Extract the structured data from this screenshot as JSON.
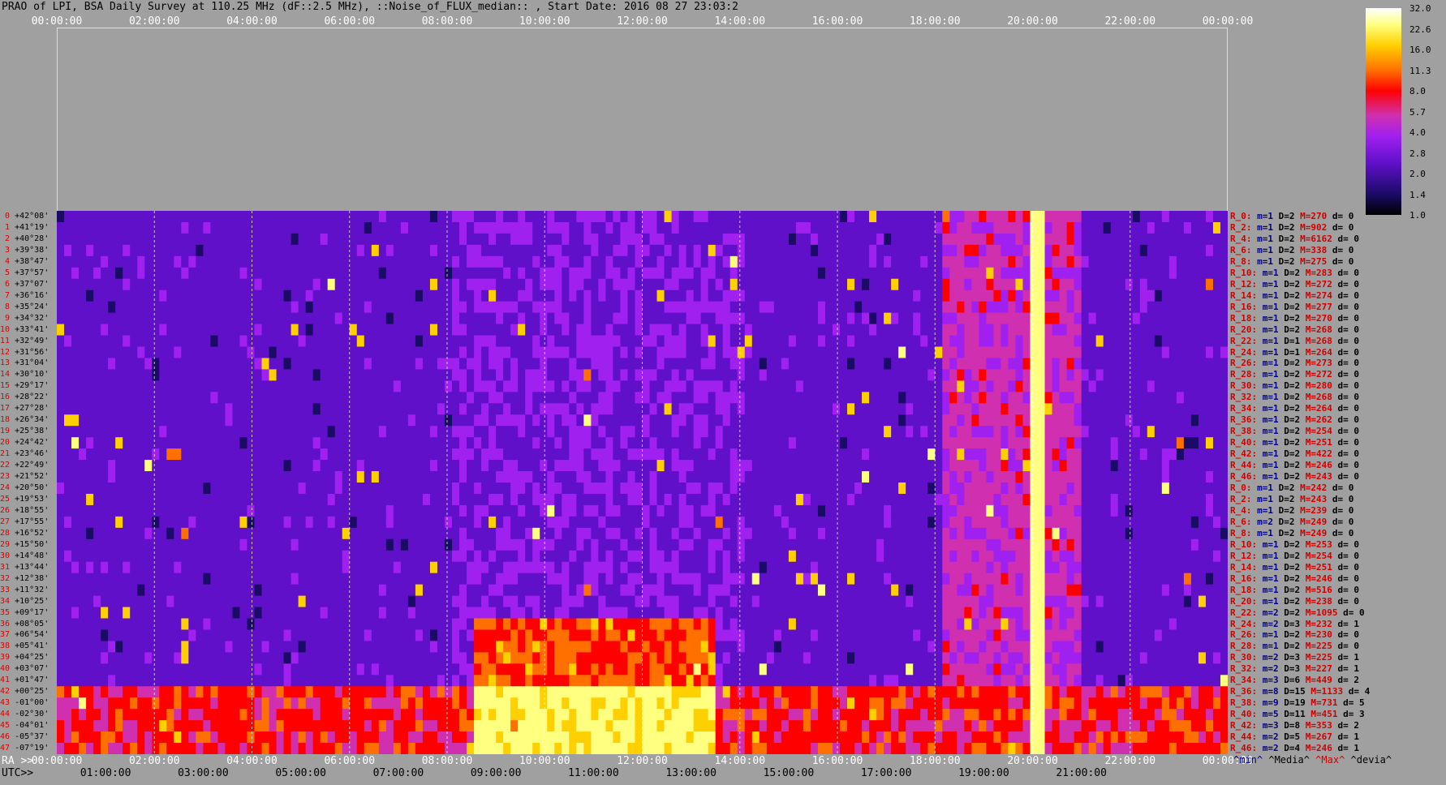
{
  "title": "PRAO of LPI, BSA Daily Survey at 110.25 MHz (dF::2.5 MHz), ::Noise_of_FLUX_median:: , Start Date: 2016 08 27 23:03:2",
  "axes": {
    "top_ticks": [
      "00:00:00",
      "02:00:00",
      "04:00:00",
      "06:00:00",
      "08:00:00",
      "10:00:00",
      "12:00:00",
      "14:00:00",
      "16:00:00",
      "18:00:00",
      "20:00:00",
      "22:00:00",
      "00:00:00"
    ],
    "ra_label": "RA >>",
    "ra_ticks": [
      "00:00:00",
      "02:00:00",
      "04:00:00",
      "06:00:00",
      "08:00:00",
      "10:00:00",
      "12:00:00",
      "14:00:00",
      "16:00:00",
      "18:00:00",
      "20:00:00",
      "22:00:00",
      "00:00:00"
    ],
    "utc_label": "UTC>>",
    "utc_ticks": [
      "01:00:00",
      "03:00:00",
      "05:00:00",
      "07:00:00",
      "09:00:00",
      "11:00:00",
      "13:00:00",
      "15:00:00",
      "17:00:00",
      "19:00:00",
      "21:00:00"
    ]
  },
  "colorbar": {
    "labels": [
      "32.0",
      "22.6",
      "16.0",
      "11.3",
      "8.0",
      "5.7",
      "4.0",
      "2.8",
      "2.0",
      "1.4",
      "1.0"
    ],
    "colors": [
      "#000000",
      "#1a0b66",
      "#6010c8",
      "#a020f0",
      "#d030b0",
      "#ff0000",
      "#ff7000",
      "#ffd000",
      "#ffff80",
      "#ffffff"
    ]
  },
  "legend": {
    "min": "^min^",
    "media": "^Media^",
    "max": "^Max^",
    "devia": "^devia^"
  },
  "chart_data": {
    "type": "heatmap",
    "title": "PRAO of LPI, BSA Daily Survey at 110.25 MHz (dF::2.5 MHz), ::Noise_of_FLUX_median:: , Start Date: 2016 08 27 23:03:2",
    "x_range_hours": [
      0,
      24
    ],
    "rows": 48,
    "dec_labels": [
      "+42°08'",
      "+41°19'",
      "+40°28'",
      "+39°38'",
      "+38°47'",
      "+37°57'",
      "+37°07'",
      "+36°16'",
      "+35°24'",
      "+34°32'",
      "+33°41'",
      "+32°49'",
      "+31°56'",
      "+31°04'",
      "+30°10'",
      "+29°17'",
      "+28°22'",
      "+27°28'",
      "+26°34'",
      "+25°38'",
      "+24°42'",
      "+23°46'",
      "+22°49'",
      "+21°52'",
      "+20°50'",
      "+19°53'",
      "+18°55'",
      "+17°55'",
      "+16°52'",
      "+15°50'",
      "+14°48'",
      "+13°44'",
      "+12°38'",
      "+11°32'",
      "+10°25'",
      "+09°17'",
      "+08°05'",
      "+06°54'",
      "+05°41'",
      "+04°25'",
      "+03°07'",
      "+01°47'",
      "+00°25'",
      "-01°00'",
      "-02°30'",
      "-04°01'",
      "-05°37'",
      "-07°19'"
    ],
    "row_nums": [
      "0",
      "1",
      "2",
      "3",
      "4",
      "5",
      "6",
      "7",
      "8",
      "9",
      "10",
      "11",
      "12",
      "13",
      "14",
      "15",
      "16",
      "17",
      "18",
      "19",
      "20",
      "21",
      "22",
      "23",
      "24",
      "25",
      "26",
      "27",
      "28",
      "29",
      "30",
      "31",
      "32",
      "33",
      "34",
      "35",
      "36",
      "37",
      "38",
      "39",
      "40",
      "41",
      "42",
      "43",
      "44",
      "45",
      "46",
      "47"
    ],
    "stats": [
      {
        "r": "R_0:",
        "min": "1",
        "d": "2",
        "max": "270",
        "dev": "0"
      },
      {
        "r": "R_2:",
        "min": "1",
        "d": "2",
        "max": "902",
        "dev": "0"
      },
      {
        "r": "R_4:",
        "min": "1",
        "d": "2",
        "max": "6162",
        "dev": "0"
      },
      {
        "r": "R_6:",
        "min": "1",
        "d": "2",
        "max": "338",
        "dev": "0"
      },
      {
        "r": "R_8:",
        "min": "1",
        "d": "2",
        "max": "275",
        "dev": "0"
      },
      {
        "r": "R_10:",
        "min": "1",
        "d": "2",
        "max": "283",
        "dev": "0"
      },
      {
        "r": "R_12:",
        "min": "1",
        "d": "2",
        "max": "272",
        "dev": "0"
      },
      {
        "r": "R_14:",
        "min": "1",
        "d": "2",
        "max": "274",
        "dev": "0"
      },
      {
        "r": "R_16:",
        "min": "1",
        "d": "2",
        "max": "277",
        "dev": "0"
      },
      {
        "r": "R_18:",
        "min": "1",
        "d": "2",
        "max": "270",
        "dev": "0"
      },
      {
        "r": "R_20:",
        "min": "1",
        "d": "2",
        "max": "268",
        "dev": "0"
      },
      {
        "r": "R_22:",
        "min": "1",
        "d": "1",
        "max": "268",
        "dev": "0"
      },
      {
        "r": "R_24:",
        "min": "1",
        "d": "1",
        "max": "264",
        "dev": "0"
      },
      {
        "r": "R_26:",
        "min": "1",
        "d": "2",
        "max": "273",
        "dev": "0"
      },
      {
        "r": "R_28:",
        "min": "1",
        "d": "2",
        "max": "272",
        "dev": "0"
      },
      {
        "r": "R_30:",
        "min": "1",
        "d": "2",
        "max": "280",
        "dev": "0"
      },
      {
        "r": "R_32:",
        "min": "1",
        "d": "2",
        "max": "268",
        "dev": "0"
      },
      {
        "r": "R_34:",
        "min": "1",
        "d": "2",
        "max": "264",
        "dev": "0"
      },
      {
        "r": "R_36:",
        "min": "1",
        "d": "2",
        "max": "262",
        "dev": "0"
      },
      {
        "r": "R_38:",
        "min": "1",
        "d": "2",
        "max": "254",
        "dev": "0"
      },
      {
        "r": "R_40:",
        "min": "1",
        "d": "2",
        "max": "251",
        "dev": "0"
      },
      {
        "r": "R_42:",
        "min": "1",
        "d": "2",
        "max": "422",
        "dev": "0"
      },
      {
        "r": "R_44:",
        "min": "1",
        "d": "2",
        "max": "246",
        "dev": "0"
      },
      {
        "r": "R_46:",
        "min": "1",
        "d": "2",
        "max": "243",
        "dev": "0"
      },
      {
        "r": "R_0:",
        "min": "1",
        "d": "2",
        "max": "242",
        "dev": "0"
      },
      {
        "r": "R_2:",
        "min": "1",
        "d": "2",
        "max": "243",
        "dev": "0"
      },
      {
        "r": "R_4:",
        "min": "1",
        "d": "2",
        "max": "239",
        "dev": "0"
      },
      {
        "r": "R_6:",
        "min": "2",
        "d": "2",
        "max": "249",
        "dev": "0"
      },
      {
        "r": "R_8:",
        "min": "1",
        "d": "2",
        "max": "249",
        "dev": "0"
      },
      {
        "r": "R_10:",
        "min": "1",
        "d": "2",
        "max": "253",
        "dev": "0"
      },
      {
        "r": "R_12:",
        "min": "1",
        "d": "2",
        "max": "254",
        "dev": "0"
      },
      {
        "r": "R_14:",
        "min": "1",
        "d": "2",
        "max": "251",
        "dev": "0"
      },
      {
        "r": "R_16:",
        "min": "1",
        "d": "2",
        "max": "246",
        "dev": "0"
      },
      {
        "r": "R_18:",
        "min": "1",
        "d": "2",
        "max": "516",
        "dev": "0"
      },
      {
        "r": "R_20:",
        "min": "1",
        "d": "2",
        "max": "238",
        "dev": "0"
      },
      {
        "r": "R_22:",
        "min": "2",
        "d": "2",
        "max": "1095",
        "dev": "0"
      },
      {
        "r": "R_24:",
        "min": "2",
        "d": "3",
        "max": "232",
        "dev": "1"
      },
      {
        "r": "R_26:",
        "min": "1",
        "d": "2",
        "max": "230",
        "dev": "0"
      },
      {
        "r": "R_28:",
        "min": "1",
        "d": "2",
        "max": "225",
        "dev": "0"
      },
      {
        "r": "R_30:",
        "min": "2",
        "d": "3",
        "max": "225",
        "dev": "1"
      },
      {
        "r": "R_32:",
        "min": "2",
        "d": "3",
        "max": "227",
        "dev": "1"
      },
      {
        "r": "R_34:",
        "min": "3",
        "d": "6",
        "max": "449",
        "dev": "2"
      },
      {
        "r": "R_36:",
        "min": "8",
        "d": "15",
        "max": "1133",
        "dev": "4"
      },
      {
        "r": "R_38:",
        "min": "9",
        "d": "19",
        "max": "731",
        "dev": "5"
      },
      {
        "r": "R_40:",
        "min": "5",
        "d": "11",
        "max": "451",
        "dev": "3"
      },
      {
        "r": "R_42:",
        "min": "3",
        "d": "8",
        "max": "353",
        "dev": "2"
      },
      {
        "r": "R_44:",
        "min": "2",
        "d": "5",
        "max": "267",
        "dev": "1"
      },
      {
        "r": "R_46:",
        "min": "2",
        "d": "4",
        "max": "246",
        "dev": "1"
      }
    ]
  }
}
